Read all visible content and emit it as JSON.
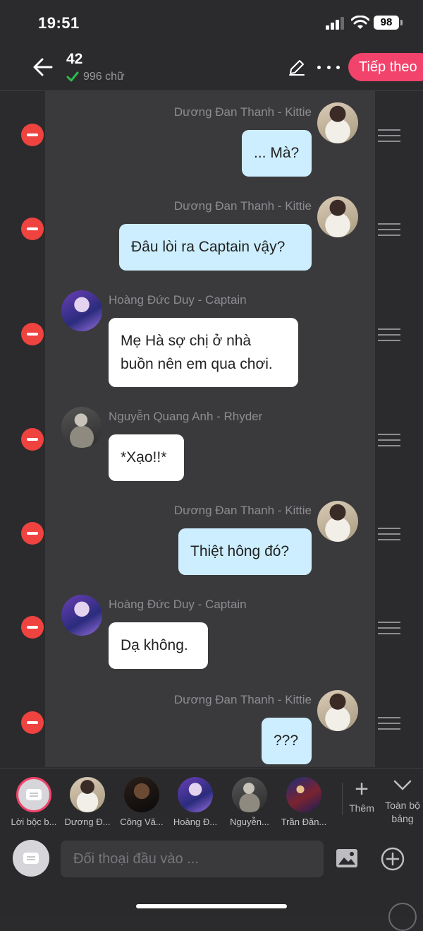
{
  "status_bar": {
    "time": "19:51",
    "battery": "98"
  },
  "header": {
    "title": "42",
    "word_count": "996 chữ",
    "next_label": "Tiếp theo"
  },
  "messages": [
    {
      "speaker": "Dương Đan Thanh - Kittie",
      "text": "... Mà?",
      "side": "right"
    },
    {
      "speaker": "Dương Đan Thanh - Kittie",
      "text": "Đâu lòi ra Captain vậy?",
      "side": "right"
    },
    {
      "speaker": "Hoàng Đức Duy - Captain",
      "text": "Mẹ Hà sợ chị ở nhà buồn nên em qua chơi.",
      "side": "left"
    },
    {
      "speaker": "Nguyễn Quang Anh - Rhyder",
      "text": "*Xạo!!*",
      "side": "left"
    },
    {
      "speaker": "Dương Đan Thanh - Kittie",
      "text": "Thiệt hông đó?",
      "side": "right"
    },
    {
      "speaker": "Hoàng Đức Duy - Captain",
      "text": "Dạ không.",
      "side": "left"
    },
    {
      "speaker": "Dương Đan Thanh - Kittie",
      "text": "???",
      "side": "right"
    }
  ],
  "characters": [
    {
      "label": "Lời bộc b...",
      "icon": "narrator-note-icon"
    },
    {
      "label": "Dương Đ..."
    },
    {
      "label": "Công Vă..."
    },
    {
      "label": "Hoàng Đ..."
    },
    {
      "label": "Nguyễn..."
    },
    {
      "label": "Trần Đăn..."
    }
  ],
  "char_bar": {
    "add_label": "Thêm",
    "full_table_label": "Toàn bộ bảng"
  },
  "input": {
    "placeholder": "Đối thoại đầu vào ..."
  },
  "colors": {
    "accent": "#f1436b",
    "delete": "#ef4340",
    "my_bubble": "#cdeefe",
    "other_bubble": "#ffffff"
  }
}
